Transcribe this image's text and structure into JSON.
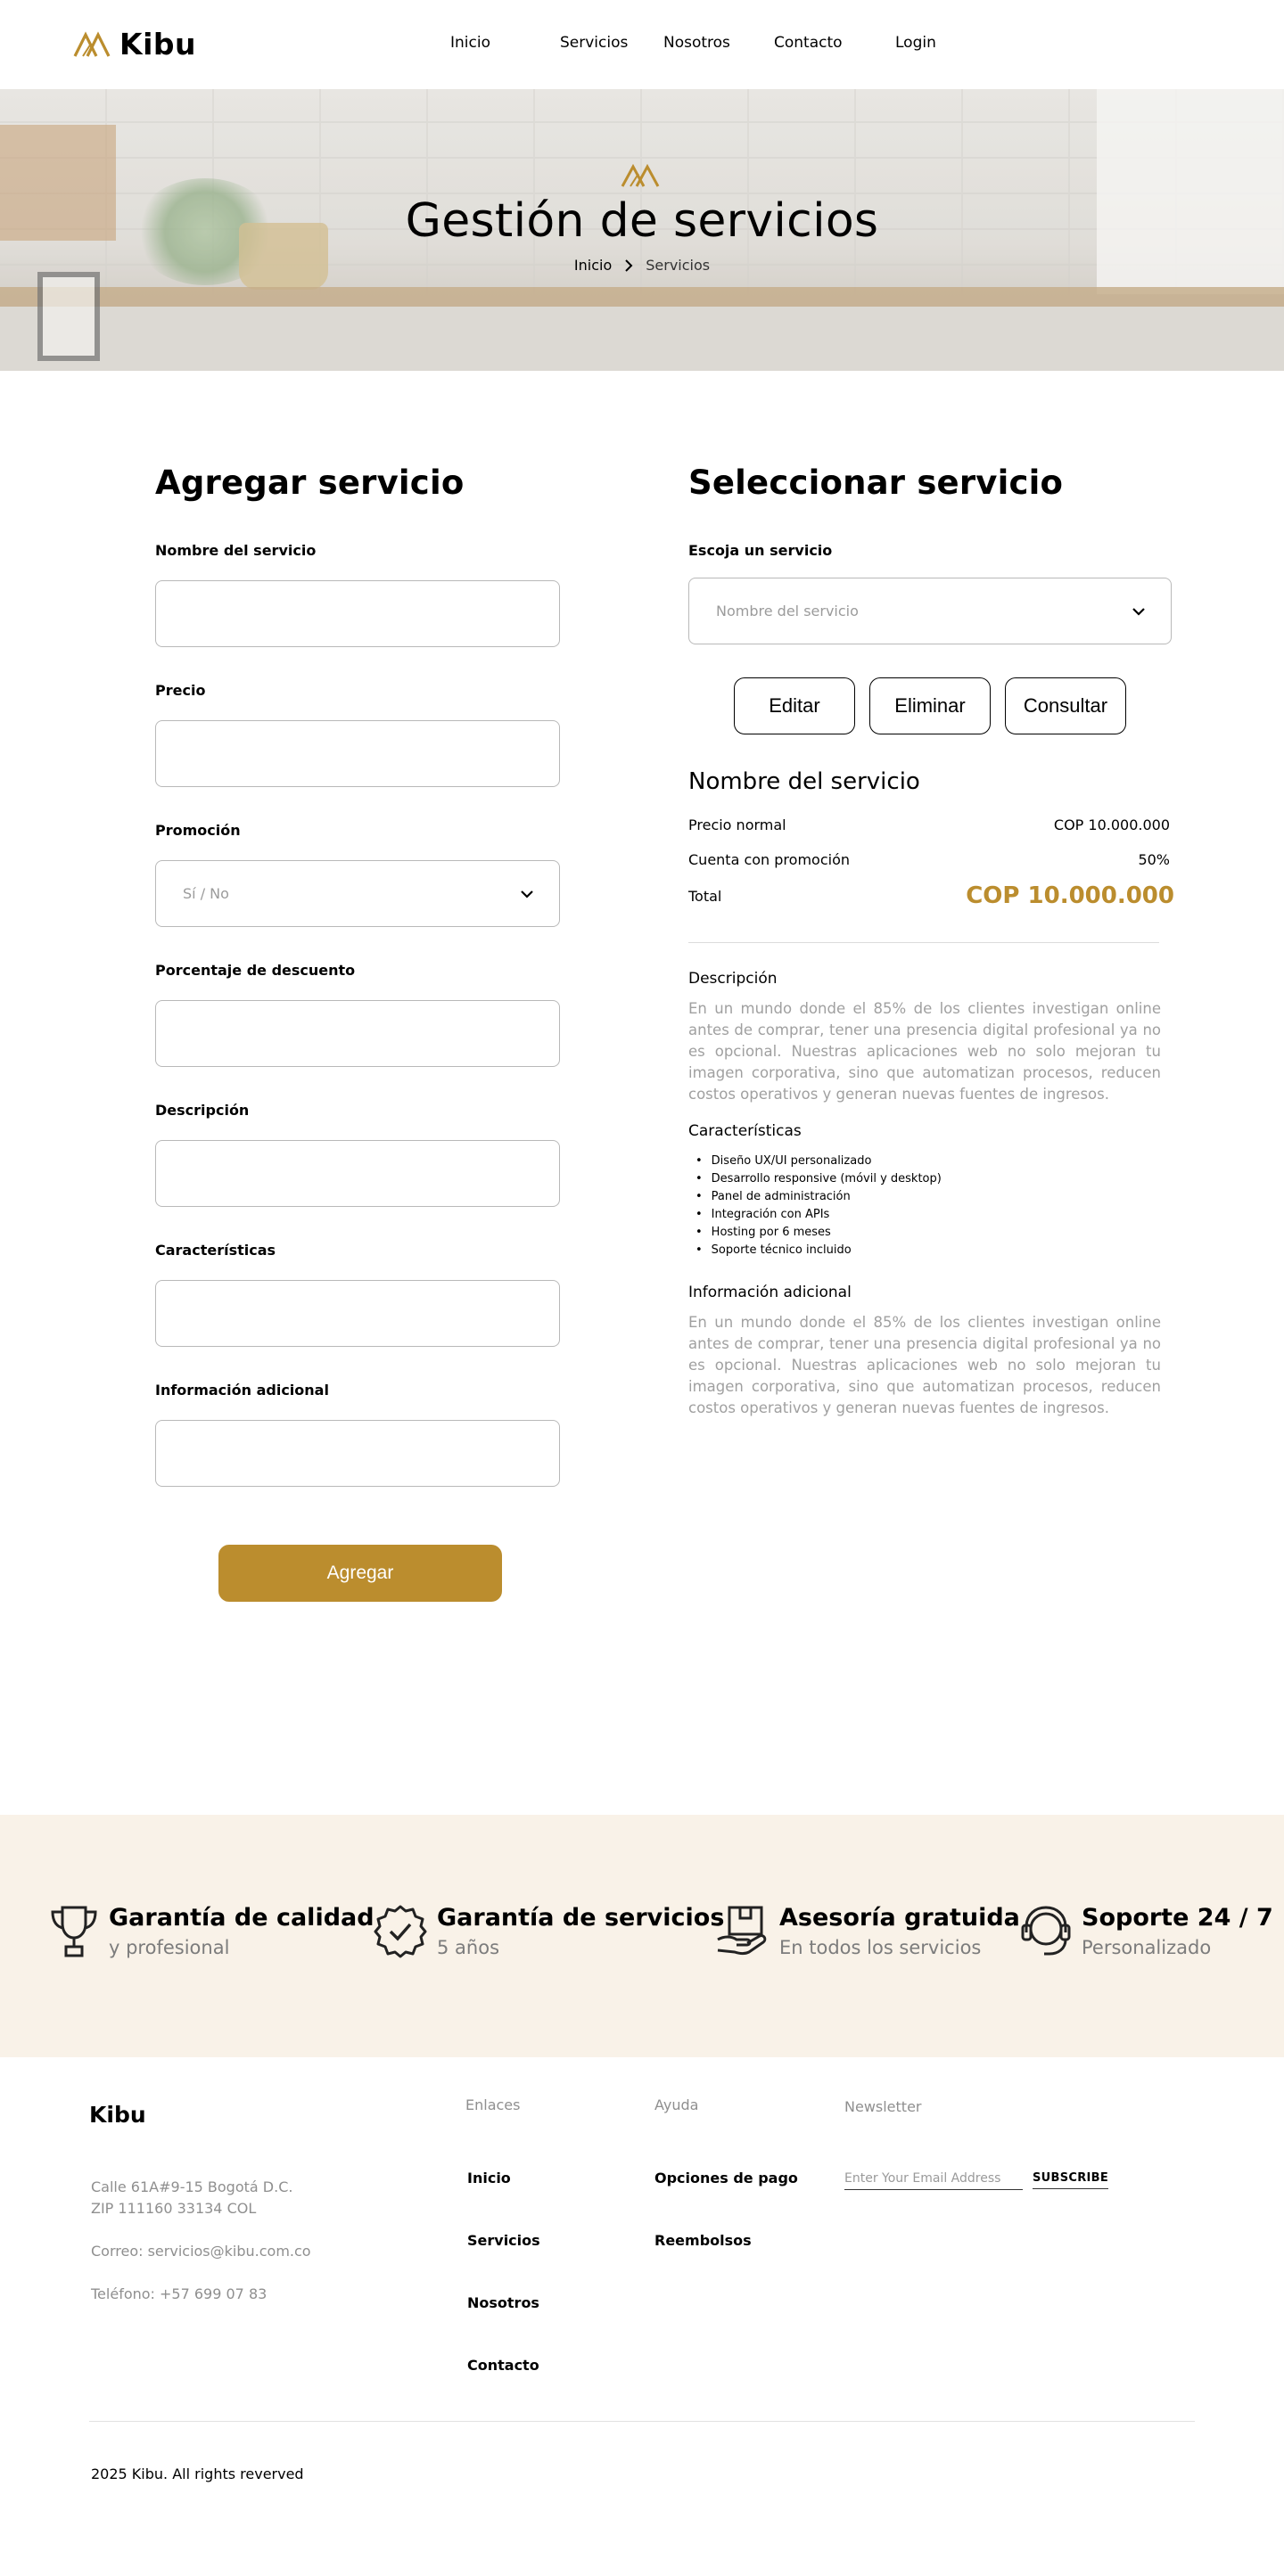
{
  "brand": {
    "name": "Kibu",
    "accent": "#bb8d2e"
  },
  "nav": {
    "items": [
      "Inicio",
      "Servicios",
      "Nosotros",
      "Contacto",
      "Login"
    ]
  },
  "hero": {
    "title": "Gestión de servicios",
    "breadcrumb": {
      "home": "Inicio",
      "current": "Servicios"
    }
  },
  "add_form": {
    "title": "Agregar servicio",
    "fields": {
      "name": {
        "label": "Nombre del servicio",
        "value": ""
      },
      "price": {
        "label": "Precio",
        "value": ""
      },
      "promo": {
        "label": "Promoción",
        "placeholder": "Sí / No"
      },
      "discount": {
        "label": "Porcentaje de descuento",
        "value": ""
      },
      "description": {
        "label": "Descripción",
        "value": ""
      },
      "features": {
        "label": "Características",
        "value": ""
      },
      "extra": {
        "label": "Información adicional",
        "value": ""
      }
    },
    "submit_label": "Agregar"
  },
  "select_panel": {
    "title": "Seleccionar servicio",
    "select_label": "Escoja un servicio",
    "select_placeholder": "Nombre del servicio",
    "buttons": {
      "edit": "Editar",
      "delete": "Eliminar",
      "consult": "Consultar"
    },
    "service_name": "Nombre del servicio",
    "rows": {
      "normal_price": {
        "label": "Precio normal",
        "value": "COP 10.000.000"
      },
      "promo": {
        "label": "Cuenta con promoción",
        "value": "50%"
      },
      "total": {
        "label": "Total",
        "value": "COP 10.000.000"
      }
    },
    "description": {
      "title": "Descripción",
      "text": "En un mundo donde el 85% de los clientes investigan online antes de comprar, tener una presencia digital profesional ya no es opcional. Nuestras aplicaciones web no solo mejoran tu imagen corporativa, sino que automatizan procesos, reducen costos operativos y generan nuevas fuentes de ingresos."
    },
    "features": {
      "title": "Características",
      "items": [
        "Diseño UX/UI personalizado",
        "Desarrollo responsive (móvil y desktop)",
        "Panel de administración",
        "Integración con APIs",
        "Hosting por 6 meses",
        "Soporte técnico incluido"
      ]
    },
    "extra": {
      "title": "Información adicional",
      "text": "En un mundo donde el 85% de los clientes investigan online antes de comprar, tener una presencia digital profesional ya no es opcional. Nuestras aplicaciones web no solo mejoran tu imagen corporativa, sino que automatizan procesos, reducen costos operativos y generan nuevas fuentes de ingresos."
    }
  },
  "benefits": [
    {
      "icon": "trophy-icon",
      "title": "Garantía de calidad",
      "subtitle": "y profesional"
    },
    {
      "icon": "badge-check-icon",
      "title": "Garantía de servicios",
      "subtitle": "5 años"
    },
    {
      "icon": "box-hand-icon",
      "title": "Asesoría gratuida",
      "subtitle": "En todos los servicios"
    },
    {
      "icon": "headset-icon",
      "title": "Soporte 24 / 7",
      "subtitle": "Personalizado"
    }
  ],
  "footer": {
    "logo": "Kibu",
    "address_line1": "Calle 61A#9-15 Bogotá D.C.",
    "address_line2": "ZIP 111160 33134 COL",
    "email": "Correo: servicios@kibu.com.co",
    "phone": "Teléfono: +57 699 07 83",
    "links_title": "Enlaces",
    "links": [
      "Inicio",
      "Servicios",
      "Nosotros",
      "Contacto"
    ],
    "help_title": "Ayuda",
    "help_links": [
      "Opciones de pago",
      "Reembolsos"
    ],
    "newsletter_title": "Newsletter",
    "newsletter_placeholder": "Enter Your Email Address",
    "subscribe_label": "SUBSCRIBE",
    "copyright": "2025 Kibu. All rights reverved"
  }
}
